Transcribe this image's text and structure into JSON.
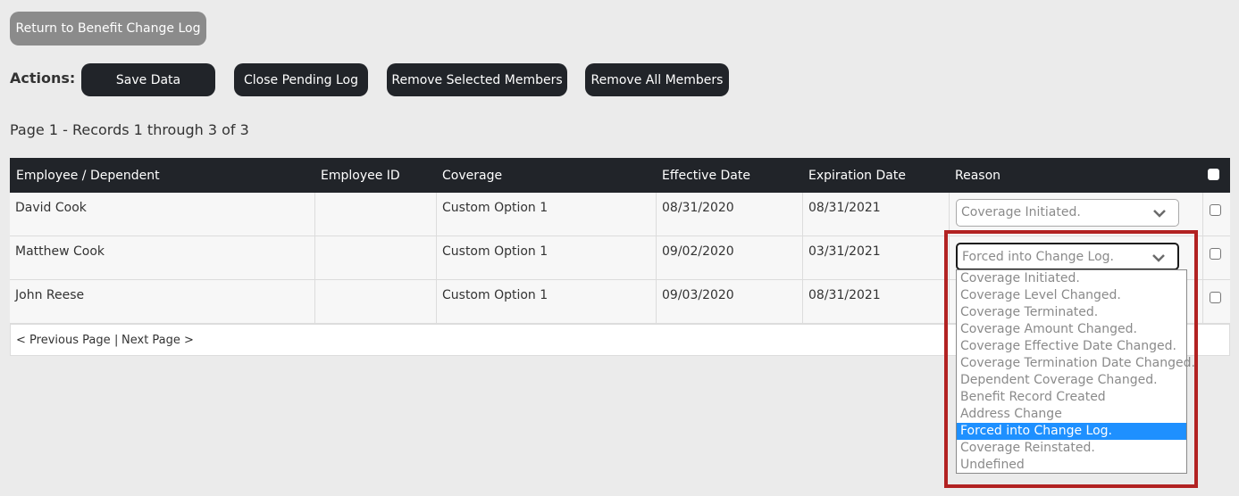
{
  "top": {
    "return_label": "Return to Benefit Change Log"
  },
  "actions": {
    "label": "Actions:",
    "buttons": [
      "Save Data",
      "Close Pending Log",
      "Remove Selected Members",
      "Remove All Members"
    ]
  },
  "records_text": "Page 1 - Records 1 through 3 of 3",
  "table": {
    "headers": [
      "Employee / Dependent",
      "Employee ID",
      "Coverage",
      "Effective Date",
      "Expiration Date",
      "Reason"
    ],
    "rows": [
      {
        "name": "David Cook",
        "employee_id": "",
        "coverage": "Custom Option 1",
        "effective": "08/31/2020",
        "expiration": "08/31/2021",
        "reason": "Coverage Initiated."
      },
      {
        "name": "Matthew Cook",
        "employee_id": "",
        "coverage": "Custom Option 1",
        "effective": "09/02/2020",
        "expiration": "03/31/2021",
        "reason": "Forced into Change Log."
      },
      {
        "name": "John Reese",
        "employee_id": "",
        "coverage": "Custom Option 1",
        "effective": "09/03/2020",
        "expiration": "08/31/2021",
        "reason": ""
      }
    ]
  },
  "pager": {
    "prev": "< Previous Page",
    "sep": "|",
    "next": "Next Page >"
  },
  "dropdown": {
    "options": [
      "Coverage Initiated.",
      "Coverage Level Changed.",
      "Coverage Terminated.",
      "Coverage Amount Changed.",
      "Coverage Effective Date Changed.",
      "Coverage Termination Date Changed.",
      "Dependent Coverage Changed.",
      "Benefit Record Created",
      "Address Change",
      "Forced into Change Log.",
      "Coverage Reinstated.",
      "Undefined"
    ],
    "selected": "Forced into Change Log."
  },
  "colors": {
    "dark": "#212429",
    "gray_button": "#8b8b8b",
    "highlight": "#b22222",
    "selection": "#1e90ff"
  },
  "icons": {
    "select_arrow": "chevron-down-icon"
  }
}
